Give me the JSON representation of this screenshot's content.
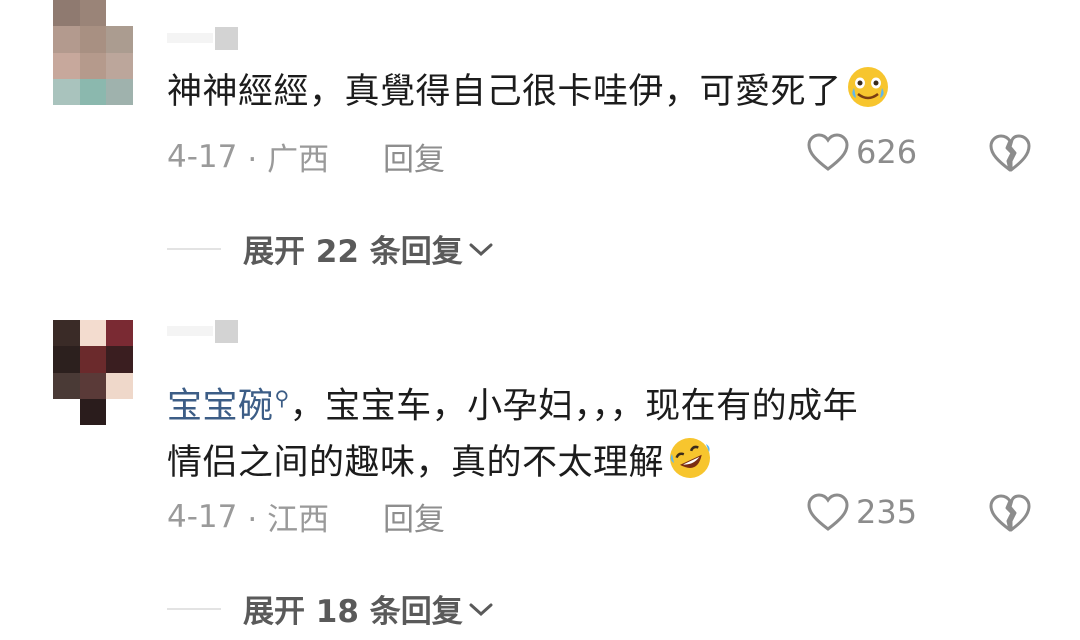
{
  "comments": [
    {
      "text": "神神經經，真覺得自己很卡哇伊，可愛死了",
      "emoji": "cry-laugh-emoji",
      "date": "4-17",
      "location": "· 广西",
      "reply_label": "回复",
      "likes": "626",
      "expand_label": "展开 22 条回复"
    },
    {
      "tag": "宝宝碗",
      "text_line1": "，宝宝车，小孕妇，，，现在有的成年",
      "text_line2": "情侣之间的趣味，真的不太理解",
      "emoji": "rolling-laugh-emoji",
      "date": "4-17",
      "location": "· 江西",
      "reply_label": "回复",
      "likes": "235",
      "expand_label": "展开 18 条回复"
    }
  ],
  "colors": {
    "tag": "#3c5d86",
    "meta": "#9a9a9a",
    "text": "#1c1c1c"
  }
}
